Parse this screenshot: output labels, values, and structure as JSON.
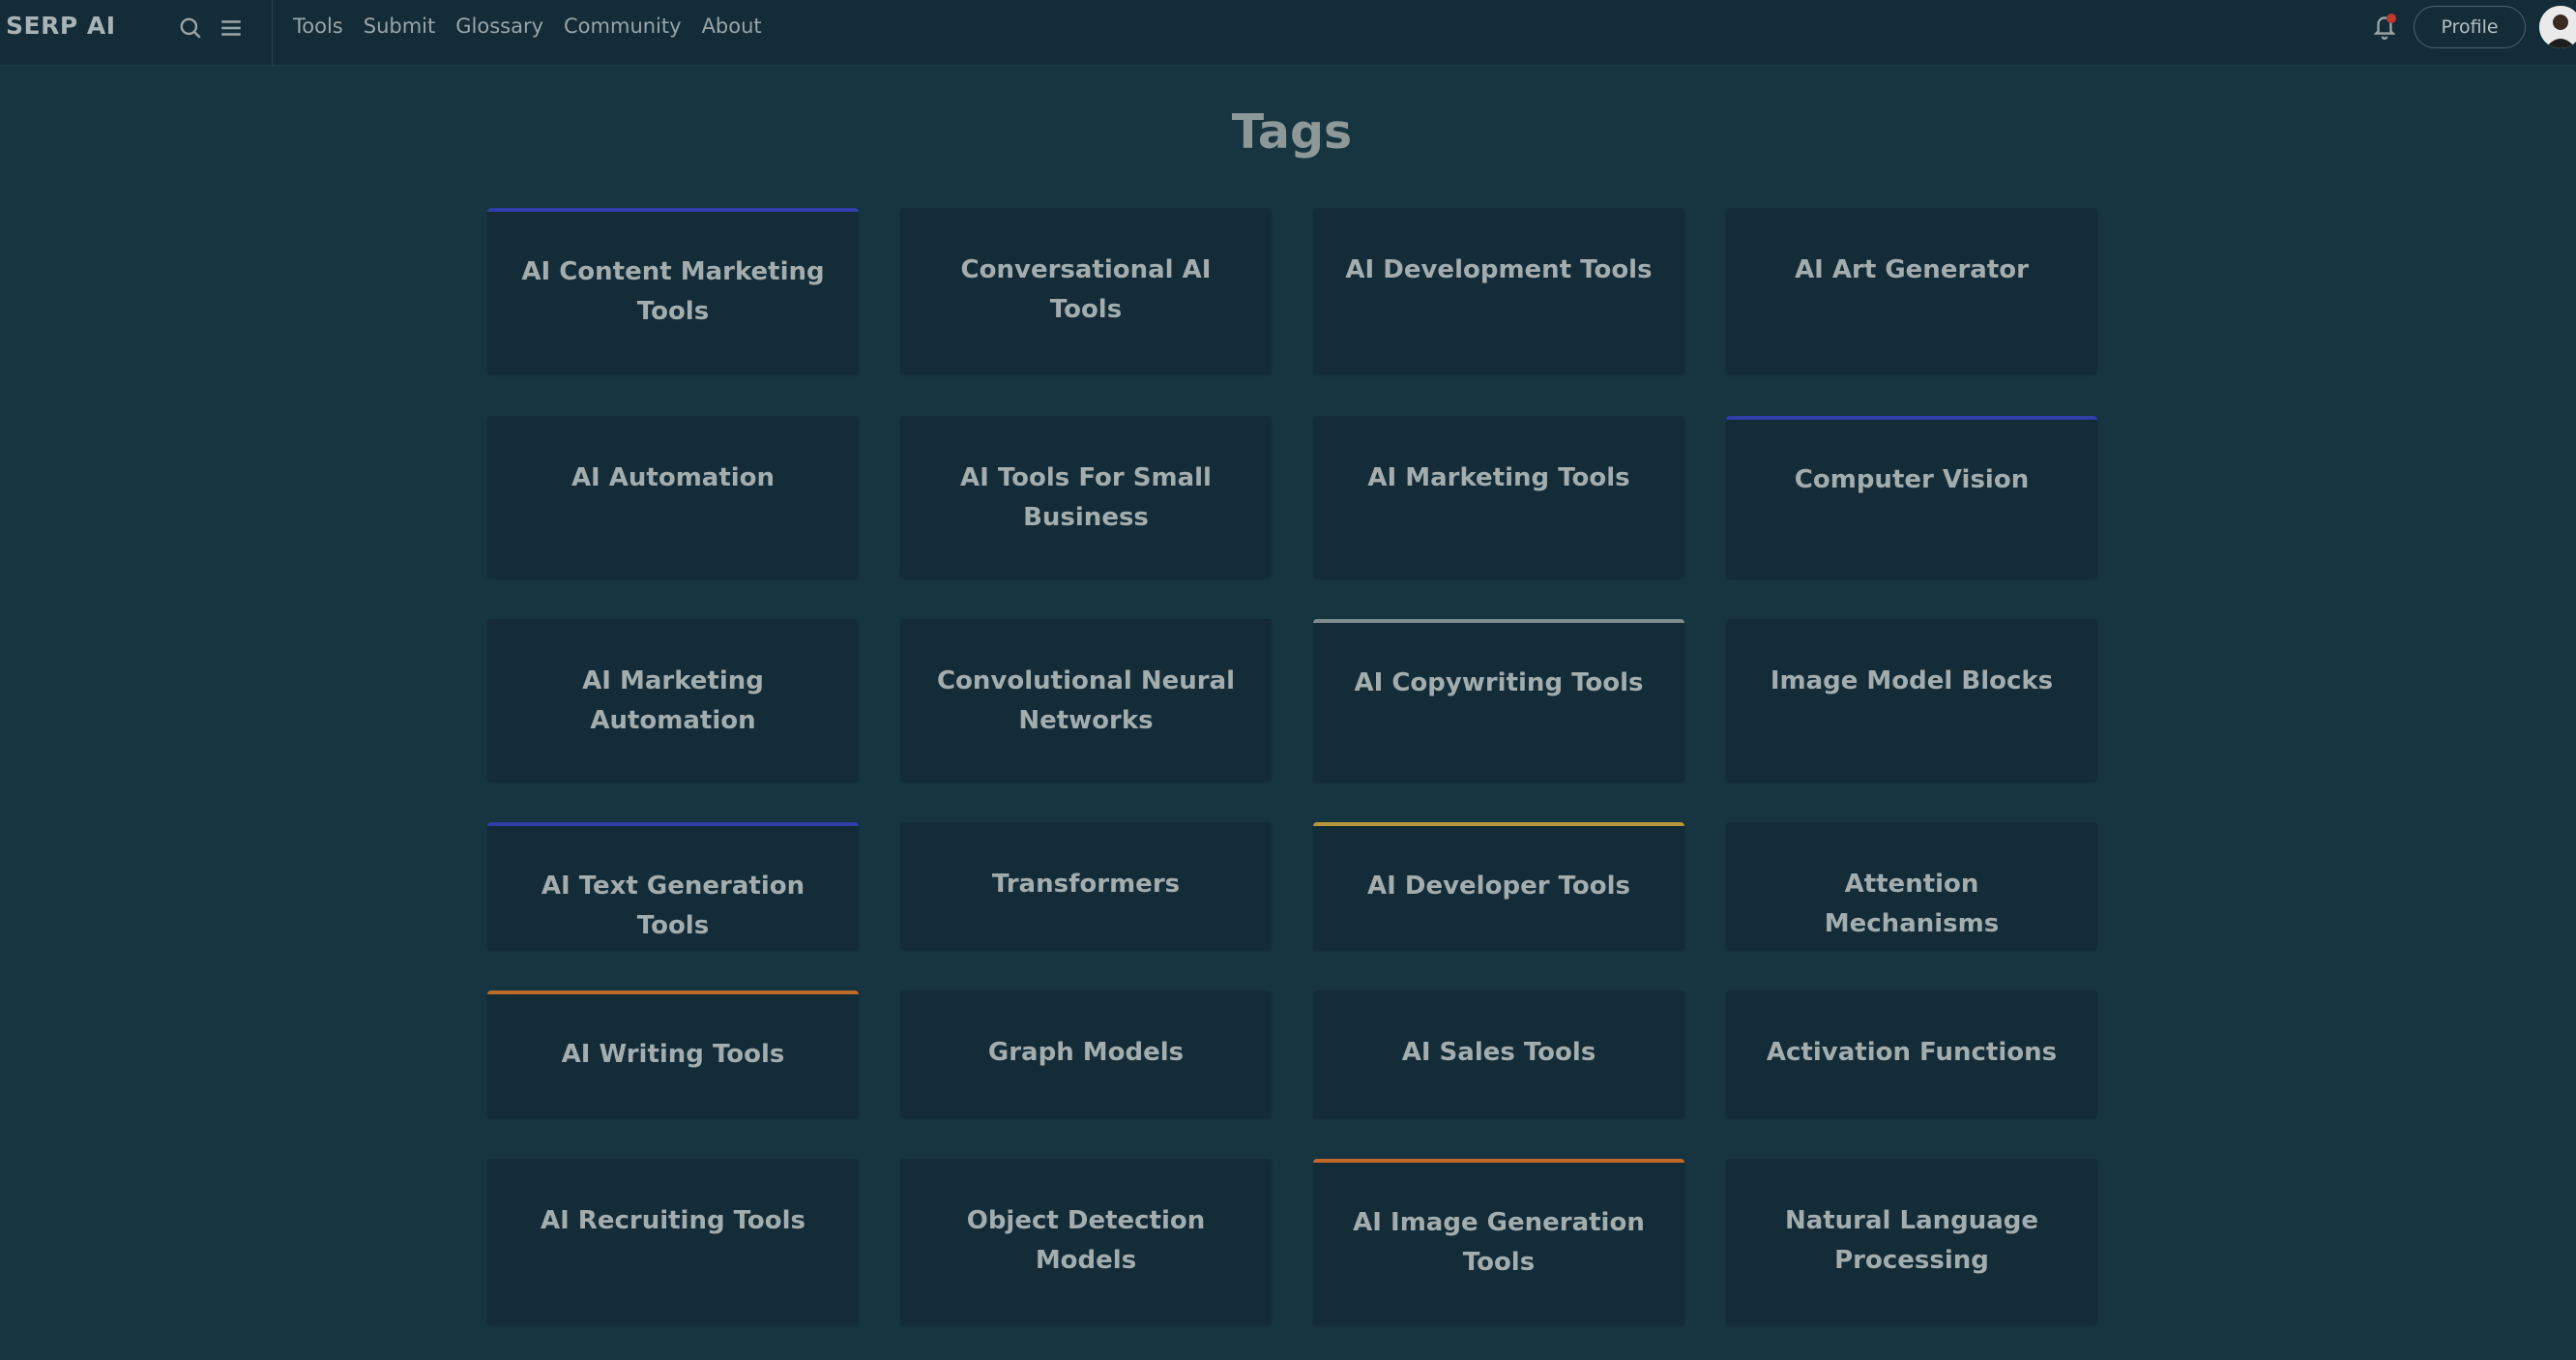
{
  "header": {
    "brand": "SERP AI",
    "nav": [
      "Tools",
      "Submit",
      "Glossary",
      "Community",
      "About"
    ],
    "profile_label": "Profile",
    "icons": {
      "search": "search-icon",
      "menu": "menu-icon",
      "bell": "bell-icon",
      "avatar": "avatar"
    }
  },
  "page": {
    "title": "Tags"
  },
  "accent_colors": {
    "blue": "#2f3ea8",
    "gray": "#7f8b8e",
    "gold": "#b8943a",
    "orange": "#c06a2a"
  },
  "tags": [
    {
      "label": "AI Content Marketing Tools",
      "accent": "blue"
    },
    {
      "label": "Conversational AI Tools",
      "accent": ""
    },
    {
      "label": "AI Development Tools",
      "accent": ""
    },
    {
      "label": "AI Art Generator",
      "accent": ""
    },
    {
      "label": "AI Automation",
      "accent": ""
    },
    {
      "label": "AI Tools For Small Business",
      "accent": ""
    },
    {
      "label": "AI Marketing Tools",
      "accent": ""
    },
    {
      "label": "Computer Vision",
      "accent": "blue"
    },
    {
      "label": "AI Marketing Automation",
      "accent": ""
    },
    {
      "label": "Convolutional Neural Networks",
      "accent": ""
    },
    {
      "label": "AI Copywriting Tools",
      "accent": "gray"
    },
    {
      "label": "Image Model Blocks",
      "accent": ""
    },
    {
      "label": "AI Text Generation Tools",
      "accent": "blue"
    },
    {
      "label": "Transformers",
      "accent": ""
    },
    {
      "label": "AI Developer Tools",
      "accent": "gold"
    },
    {
      "label": "Attention Mechanisms",
      "accent": ""
    },
    {
      "label": "AI Writing Tools",
      "accent": "orange"
    },
    {
      "label": "Graph Models",
      "accent": ""
    },
    {
      "label": "AI Sales Tools",
      "accent": ""
    },
    {
      "label": "Activation Functions",
      "accent": ""
    },
    {
      "label": "AI Recruiting Tools",
      "accent": ""
    },
    {
      "label": "Object Detection Models",
      "accent": ""
    },
    {
      "label": "AI Image Generation Tools",
      "accent": "orange"
    },
    {
      "label": "Natural Language Processing",
      "accent": ""
    }
  ]
}
